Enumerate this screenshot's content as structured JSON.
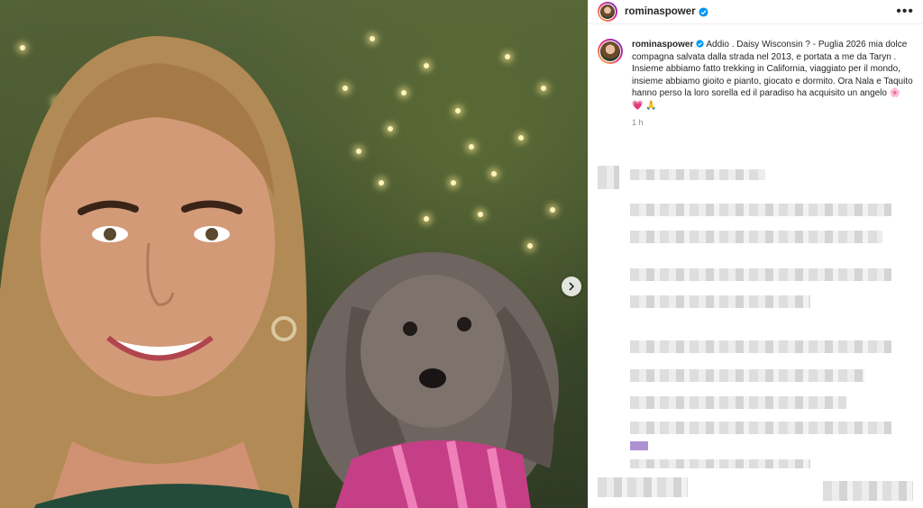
{
  "post": {
    "username": "rominaspower",
    "caption": "Addio . Daisy Wisconsin ? - Puglia 2026 mia dolce compagna salvata dalla strada nel 2013, e portata a me da Taryn . Insieme abbiamo fatto trekking in California, viaggiato per il mondo, insieme abbiamo gioito e pianto, giocato e dormito. Ora Nala e Taquito hanno perso la loro sorella ed il paradiso ha acquisito un angelo 🌸 💗 🙏",
    "time": "1 h"
  },
  "icons": {
    "verified": "verified-badge-icon",
    "more": "more-options-icon",
    "next": "chevron-right-icon"
  },
  "colors": {
    "verified": "#0095f6",
    "text": "#262626",
    "muted": "#8e8e8e"
  }
}
